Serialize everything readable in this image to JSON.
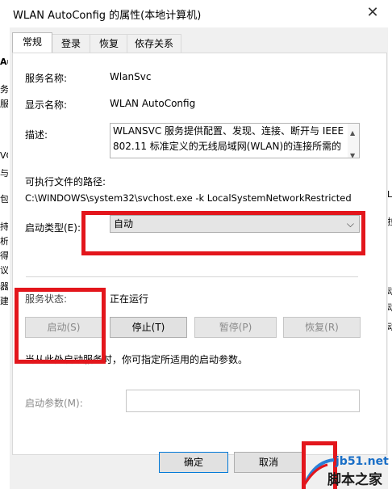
{
  "window": {
    "title": "WLAN AutoConfig 的属性(本地计算机)",
    "close_icon": "close-icon"
  },
  "tabs": [
    {
      "label": "常规",
      "active": true
    },
    {
      "label": "登录",
      "active": false
    },
    {
      "label": "恢复",
      "active": false
    },
    {
      "label": "依存关系",
      "active": false
    }
  ],
  "general": {
    "service_name_label": "服务名称:",
    "service_name": "WlanSvc",
    "display_name_label": "显示名称:",
    "display_name": "WLAN AutoConfig",
    "description_label": "描述:",
    "description_line1": "WLANSVC 服务提供配置、发现、连接、断开与 IEEE",
    "description_line2": "802.11 标准定义的无线局域网(WLAN)的连接所需的",
    "exe_path_label": "可执行文件的路径:",
    "exe_path": "C:\\WINDOWS\\system32\\svchost.exe -k LocalSystemNetworkRestricted",
    "startup_type_label": "启动类型(E):",
    "startup_type_value": "自动",
    "service_status_label": "服务状态:",
    "service_status_value": "正在运行",
    "buttons": {
      "start": "启动(S)",
      "stop": "停止(T)",
      "pause": "暂停(P)",
      "resume": "恢复(R)"
    },
    "hint": "当从此处启动服务时，你可指定所适用的启动参数。",
    "start_params_label": "启动参数(M):",
    "start_params_value": ""
  },
  "footer": {
    "ok": "确定",
    "cancel": "取消"
  },
  "watermark": {
    "site": "jb51.net",
    "brand": "脚本之家"
  },
  "background_fragments": {
    "left": [
      "Au",
      "务",
      "服",
      "VC",
      "与",
      "包",
      "持",
      "析",
      "得",
      "议",
      "器",
      "建"
    ],
    "right": [
      "L",
      "拉",
      "动",
      "动",
      "动"
    ]
  },
  "colors": {
    "annotation_red": "#e3161c",
    "dialog_bg": "#f0f0f0",
    "panel_bg": "#ffffff"
  }
}
